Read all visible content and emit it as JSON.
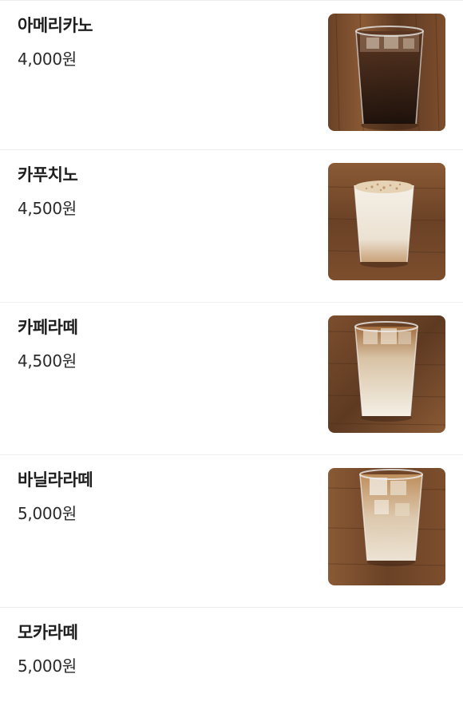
{
  "menu": {
    "items": [
      {
        "name": "아메리카노",
        "price": "4,000원",
        "image": "iced-americano-photo",
        "drink_top": "#3a2418",
        "drink_bottom": "#1a0f0a",
        "foam": ""
      },
      {
        "name": "카푸치노",
        "price": "4,500원",
        "image": "iced-cappuccino-photo",
        "drink_top": "#f2ece2",
        "drink_bottom": "#e7dccb",
        "foam": "#dcc7a8"
      },
      {
        "name": "카페라떼",
        "price": "4,500원",
        "image": "iced-cafe-latte-photo",
        "drink_top": "#b07a48",
        "drink_bottom": "#f3eee4",
        "foam": ""
      },
      {
        "name": "바닐라라떼",
        "price": "5,000원",
        "image": "iced-vanilla-latte-photo",
        "drink_top": "#c2925f",
        "drink_bottom": "#f1e8da",
        "foam": ""
      },
      {
        "name": "모카라떼",
        "price": "5,000원",
        "image": "",
        "drink_top": "",
        "drink_bottom": "",
        "foam": ""
      }
    ]
  },
  "colors": {
    "divider": "#eeeeee",
    "wood_light": "#8a5a35",
    "wood_dark": "#5e3a22",
    "text_primary": "#1e1e1e"
  }
}
